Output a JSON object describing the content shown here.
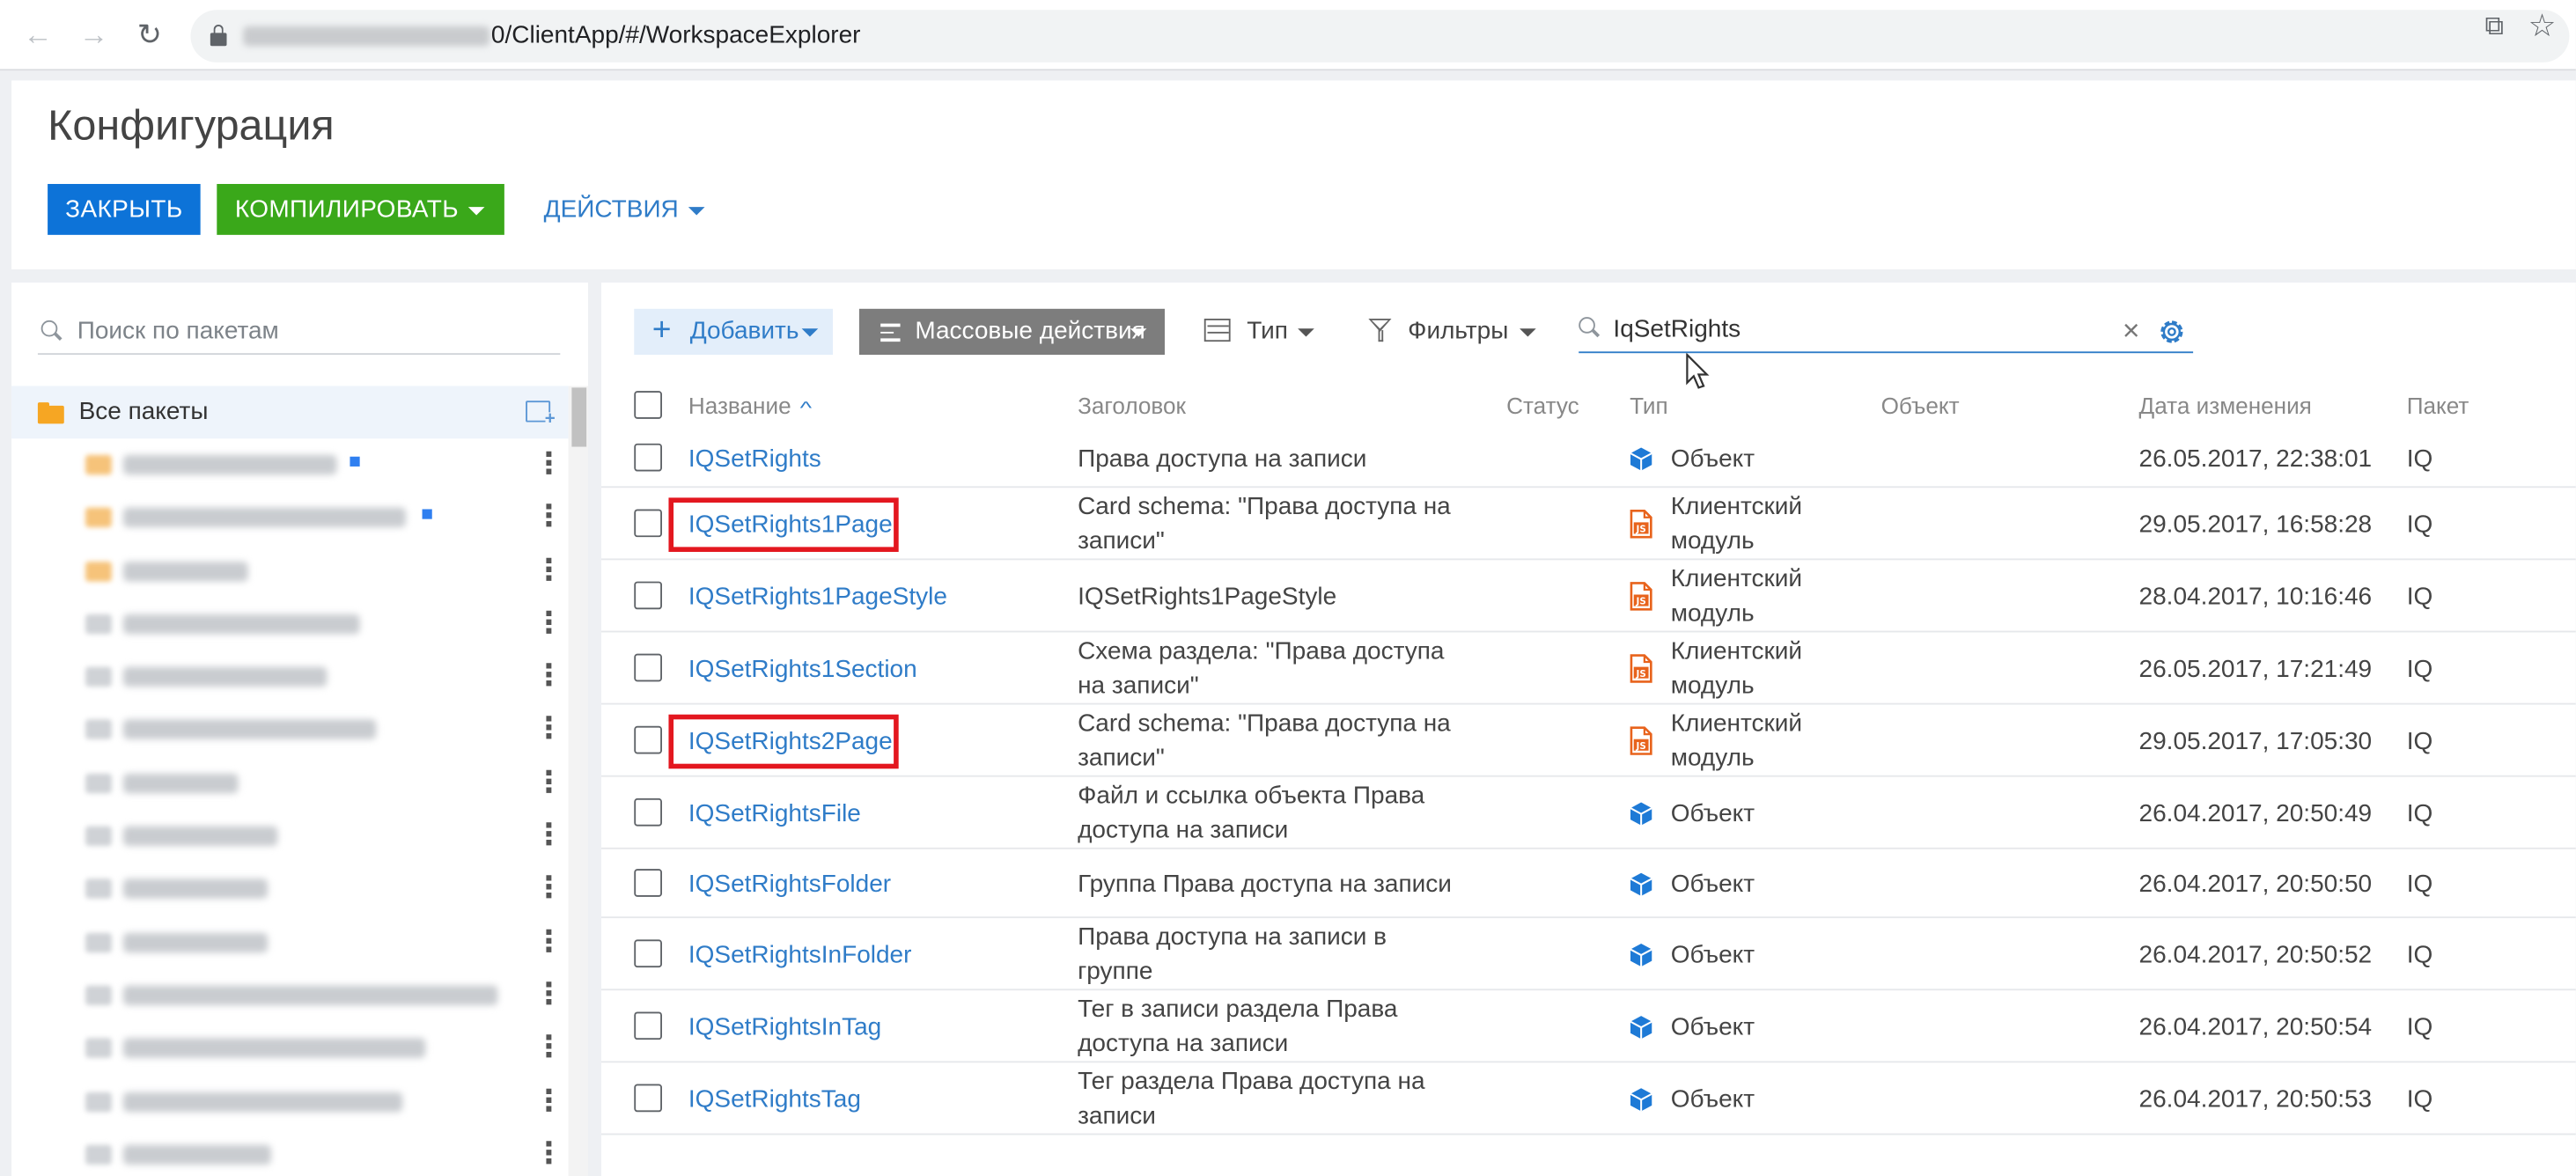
{
  "browser": {
    "url_suffix": "0/ClientApp/#/WorkspaceExplorer"
  },
  "header": {
    "title": "Конфигурация",
    "close_label": "ЗАКРЫТЬ",
    "compile_label": "КОМПИЛИРОВАТЬ",
    "actions_label": "ДЕЙСТВИЯ"
  },
  "packages": {
    "search_placeholder": "Поиск по пакетам",
    "all_label": "Все пакеты",
    "items_count": 14
  },
  "toolbar": {
    "add_label": "Добавить",
    "mass_label": "Массовые действия",
    "type_label": "Тип",
    "filters_label": "Фильтры",
    "search_value": "IqSetRights"
  },
  "table": {
    "columns": {
      "name": "Название",
      "title": "Заголовок",
      "status": "Статус",
      "type": "Тип",
      "object": "Объект",
      "date": "Дата изменения",
      "package": "Пакет"
    },
    "rows": [
      {
        "name": "IQSetRights",
        "title": "Права доступа на записи",
        "type": "Объект",
        "icon": "cube-icon",
        "date": "26.05.2017, 22:38:01",
        "package": "IQ",
        "highlight": false
      },
      {
        "name": "IQSetRights1Page",
        "title": "Card schema: \"Права доступа на записи\"",
        "type": "Клиентский модуль",
        "icon": "js-file-icon",
        "date": "29.05.2017, 16:58:28",
        "package": "IQ",
        "highlight": true
      },
      {
        "name": "IQSetRights1PageStyle",
        "title": "IQSetRights1PageStyle",
        "type": "Клиентский модуль",
        "icon": "js-file-icon",
        "date": "28.04.2017, 10:16:46",
        "package": "IQ",
        "highlight": false
      },
      {
        "name": "IQSetRights1Section",
        "title": "Схема раздела: \"Права доступа на записи\"",
        "type": "Клиентский модуль",
        "icon": "js-file-icon",
        "date": "26.05.2017, 17:21:49",
        "package": "IQ",
        "highlight": false
      },
      {
        "name": "IQSetRights2Page",
        "title": "Card schema: \"Права доступа на записи\"",
        "type": "Клиентский модуль",
        "icon": "js-file-icon",
        "date": "29.05.2017, 17:05:30",
        "package": "IQ",
        "highlight": true
      },
      {
        "name": "IQSetRightsFile",
        "title": "Файл и ссылка объекта Права доступа на записи",
        "type": "Объект",
        "icon": "cube-icon",
        "date": "26.04.2017, 20:50:49",
        "package": "IQ",
        "highlight": false
      },
      {
        "name": "IQSetRightsFolder",
        "title": "Группа Права доступа на записи",
        "type": "Объект",
        "icon": "cube-icon",
        "date": "26.04.2017, 20:50:50",
        "package": "IQ",
        "highlight": false
      },
      {
        "name": "IQSetRightsInFolder",
        "title": "Права доступа на записи в группе",
        "type": "Объект",
        "icon": "cube-icon",
        "date": "26.04.2017, 20:50:52",
        "package": "IQ",
        "highlight": false
      },
      {
        "name": "IQSetRightsInTag",
        "title": "Тег в записи раздела Права доступа на записи",
        "type": "Объект",
        "icon": "cube-icon",
        "date": "26.04.2017, 20:50:54",
        "package": "IQ",
        "highlight": false
      },
      {
        "name": "IQSetRightsTag",
        "title": "Тег раздела Права доступа на записи",
        "type": "Объект",
        "icon": "cube-icon",
        "date": "26.04.2017, 20:50:53",
        "package": "IQ",
        "highlight": false
      }
    ]
  }
}
